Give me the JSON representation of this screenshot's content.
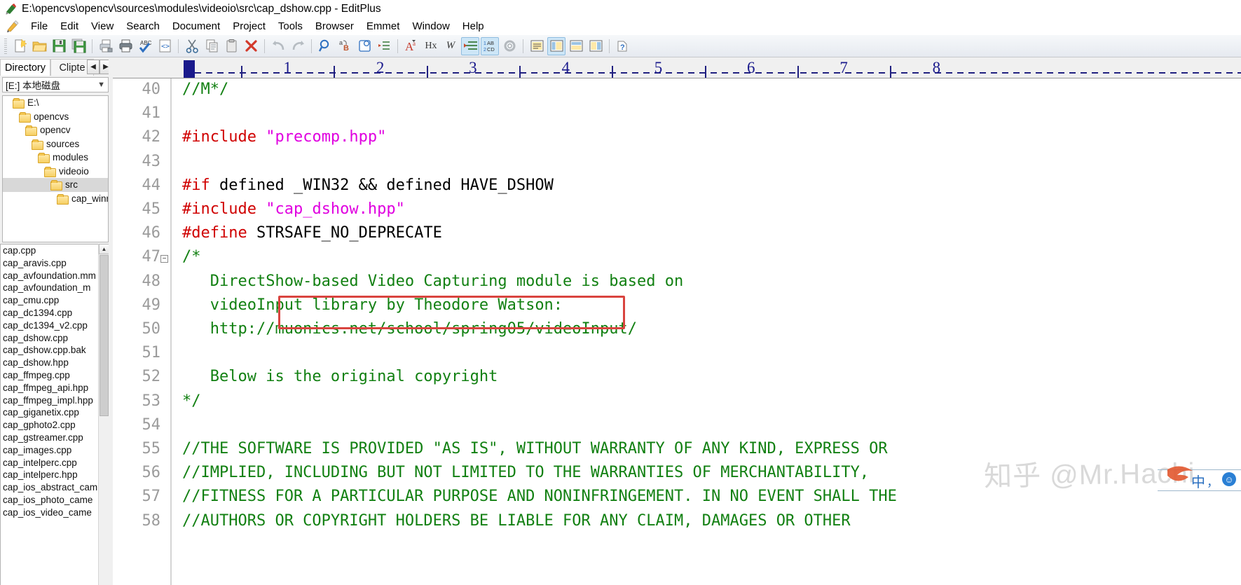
{
  "window": {
    "title": "E:\\opencvs\\opencv\\sources\\modules\\videoio\\src\\cap_dshow.cpp - EditPlus",
    "app_icon": "editplus-icon"
  },
  "menu": {
    "pencil_icon": "pencil-icon",
    "items": [
      "File",
      "Edit",
      "View",
      "Search",
      "Document",
      "Project",
      "Tools",
      "Browser",
      "Emmet",
      "Window",
      "Help"
    ]
  },
  "toolbar": {
    "groups": [
      [
        {
          "name": "new-document-icon",
          "glyph": "❐",
          "active": false
        },
        {
          "name": "open-folder-icon",
          "glyph": "📂",
          "active": false
        },
        {
          "name": "save-icon",
          "glyph": "💾",
          "active": false
        },
        {
          "name": "save-all-icon",
          "glyph": "💾",
          "active": false
        }
      ],
      [
        {
          "name": "print-preview-icon",
          "glyph": "⎙",
          "active": false
        },
        {
          "name": "print-icon",
          "glyph": "⎙",
          "active": false
        },
        {
          "name": "spell-check-icon",
          "glyph": "ABC",
          "active": false
        },
        {
          "name": "browser-preview-icon",
          "glyph": "<>",
          "active": false
        }
      ],
      [
        {
          "name": "cut-icon",
          "glyph": "✂",
          "active": false
        },
        {
          "name": "copy-icon",
          "glyph": "⧉",
          "active": false
        },
        {
          "name": "paste-icon",
          "glyph": "ὌB",
          "active": false
        },
        {
          "name": "delete-icon",
          "glyph": "✕",
          "active": false
        }
      ],
      [
        {
          "name": "undo-icon",
          "glyph": "↶",
          "active": false
        },
        {
          "name": "redo-icon",
          "glyph": "↷",
          "active": false
        }
      ],
      [
        {
          "name": "find-icon",
          "glyph": "🔍",
          "active": false
        },
        {
          "name": "replace-icon",
          "glyph": "ab",
          "active": false
        },
        {
          "name": "goto-icon",
          "glyph": "➡",
          "active": false
        },
        {
          "name": "bookmark-icon",
          "glyph": "≣",
          "active": false
        }
      ],
      [
        {
          "name": "font-icon",
          "glyph": "A",
          "active": false
        },
        {
          "name": "hex-view-icon",
          "glyph": "Hx",
          "active": false
        },
        {
          "name": "word-wrap-icon",
          "glyph": "W",
          "active": false
        },
        {
          "name": "indent-icon",
          "glyph": "≡",
          "active": true
        },
        {
          "name": "line-numbers-icon",
          "glyph": "1AB",
          "active": true
        },
        {
          "name": "preferences-icon",
          "glyph": "⚙",
          "active": false
        }
      ],
      [
        {
          "name": "toggle-output-window-icon",
          "glyph": "▤",
          "active": false
        },
        {
          "name": "toggle-directory-window-icon",
          "glyph": "▥",
          "active": true
        },
        {
          "name": "toggle-document-selector-icon",
          "glyph": "▦",
          "active": false
        },
        {
          "name": "cliptext-window-icon",
          "glyph": "▧",
          "active": false
        }
      ],
      [
        {
          "name": "help-icon",
          "glyph": "?",
          "active": false
        }
      ]
    ]
  },
  "sidebar": {
    "tabs": [
      {
        "label": "Directory",
        "active": true
      },
      {
        "label": "Clipte",
        "active": false
      }
    ],
    "tab_prev_icon": "chevron-left-icon",
    "tab_next_icon": "chevron-right-icon",
    "drive": {
      "value": "[E:] 本地磁盘",
      "caret_icon": "chevron-down-icon"
    },
    "tree": [
      {
        "label": "E:\\",
        "indent": 0,
        "selected": false
      },
      {
        "label": "opencvs",
        "indent": 1,
        "selected": false
      },
      {
        "label": "opencv",
        "indent": 2,
        "selected": false
      },
      {
        "label": "sources",
        "indent": 3,
        "selected": false
      },
      {
        "label": "modules",
        "indent": 4,
        "selected": false
      },
      {
        "label": "videoio",
        "indent": 5,
        "selected": false
      },
      {
        "label": "src",
        "indent": 6,
        "selected": true
      },
      {
        "label": "cap_winrt",
        "indent": 7,
        "selected": false
      }
    ],
    "files": [
      "cap.cpp",
      "cap_aravis.cpp",
      "cap_avfoundation.mm",
      "cap_avfoundation_m",
      "cap_cmu.cpp",
      "cap_dc1394.cpp",
      "cap_dc1394_v2.cpp",
      "cap_dshow.cpp",
      "cap_dshow.cpp.bak",
      "cap_dshow.hpp",
      "cap_ffmpeg.cpp",
      "cap_ffmpeg_api.hpp",
      "cap_ffmpeg_impl.hpp",
      "cap_giganetix.cpp",
      "cap_gphoto2.cpp",
      "cap_gstreamer.cpp",
      "cap_images.cpp",
      "cap_intelperc.cpp",
      "cap_intelperc.hpp",
      "cap_ios_abstract_cam",
      "cap_ios_photo_came",
      "cap_ios_video_came"
    ],
    "scroll_up_icon": "chevron-up-icon"
  },
  "ruler": {
    "labels": [
      "1",
      "2",
      "3",
      "4",
      "5",
      "6",
      "7",
      "8"
    ],
    "caret_marker": "column-caret-marker"
  },
  "editor": {
    "first_line_number": 40,
    "lines": [
      {
        "n": "40",
        "fold": false,
        "tokens": [
          {
            "t": "//M*/",
            "c": "c-cmt"
          }
        ]
      },
      {
        "n": "41",
        "fold": false,
        "tokens": []
      },
      {
        "n": "42",
        "fold": false,
        "tokens": [
          {
            "t": "#include ",
            "c": "c-pre"
          },
          {
            "t": "\"precomp.hpp\"",
            "c": "c-str"
          }
        ]
      },
      {
        "n": "43",
        "fold": false,
        "tokens": []
      },
      {
        "n": "44",
        "fold": false,
        "tokens": [
          {
            "t": "#if",
            "c": "c-pre"
          },
          {
            "t": " defined _WIN32 && defined HAVE_DSHOW",
            "c": "c-plain"
          }
        ]
      },
      {
        "n": "45",
        "fold": false,
        "tokens": [
          {
            "t": "#include ",
            "c": "c-pre"
          },
          {
            "t": "\"cap_dshow.hpp\"",
            "c": "c-str"
          }
        ]
      },
      {
        "n": "46",
        "fold": false,
        "tokens": [
          {
            "t": "#define",
            "c": "c-pre"
          },
          {
            "t": " STRSAFE_NO_DEPRECATE",
            "c": "c-plain"
          }
        ]
      },
      {
        "n": "47",
        "fold": true,
        "tokens": [
          {
            "t": "/*",
            "c": "c-cmt"
          }
        ]
      },
      {
        "n": "48",
        "fold": false,
        "tokens": [
          {
            "t": "   DirectShow-based Video Capturing module is based on",
            "c": "c-cmt"
          }
        ]
      },
      {
        "n": "49",
        "fold": false,
        "tokens": [
          {
            "t": "   videoInput library by Theodore Watson:",
            "c": "c-cmt"
          }
        ]
      },
      {
        "n": "50",
        "fold": false,
        "tokens": [
          {
            "t": "   http://muonics.net/school/spring05/videoInput/",
            "c": "c-cmt"
          }
        ]
      },
      {
        "n": "51",
        "fold": false,
        "tokens": []
      },
      {
        "n": "52",
        "fold": false,
        "tokens": [
          {
            "t": "   Below is the original copyright",
            "c": "c-cmt"
          }
        ]
      },
      {
        "n": "53",
        "fold": false,
        "tokens": [
          {
            "t": "*/",
            "c": "c-cmt"
          }
        ]
      },
      {
        "n": "54",
        "fold": false,
        "tokens": []
      },
      {
        "n": "55",
        "fold": false,
        "tokens": [
          {
            "t": "//THE SOFTWARE IS PROVIDED \"AS IS\", WITHOUT WARRANTY OF ANY KIND, EXPRESS OR",
            "c": "c-cmt"
          }
        ]
      },
      {
        "n": "56",
        "fold": false,
        "tokens": [
          {
            "t": "//IMPLIED, INCLUDING BUT NOT LIMITED TO THE WARRANTIES OF MERCHANTABILITY,",
            "c": "c-cmt"
          }
        ]
      },
      {
        "n": "57",
        "fold": false,
        "tokens": [
          {
            "t": "//FITNESS FOR A PARTICULAR PURPOSE AND NONINFRINGEMENT. IN NO EVENT SHALL THE",
            "c": "c-cmt"
          }
        ]
      },
      {
        "n": "58",
        "fold": false,
        "tokens": [
          {
            "t": "//AUTHORS OR COPYRIGHT HOLDERS BE LIABLE FOR ANY CLAIM, DAMAGES OR OTHER",
            "c": "c-cmt"
          }
        ]
      }
    ],
    "annotation": {
      "name": "red-highlight-box",
      "target_line": "46",
      "color": "#d9443f"
    }
  },
  "watermark": {
    "text": "知乎 @Mr.Hachi"
  },
  "ime": {
    "name": "ime-language-bar",
    "chinese_mode_glyph": "中",
    "punctuation_glyph": "，",
    "smiley_glyph": "☺"
  },
  "colors": {
    "preprocessor": "#d00000",
    "string": "#e000e0",
    "comment": "#128012",
    "plain": "#000000",
    "annotation": "#d9443f",
    "ruler": "#1a1a8c",
    "selection": "#d8d8d8",
    "toolbar_active": "#cde6f7"
  }
}
